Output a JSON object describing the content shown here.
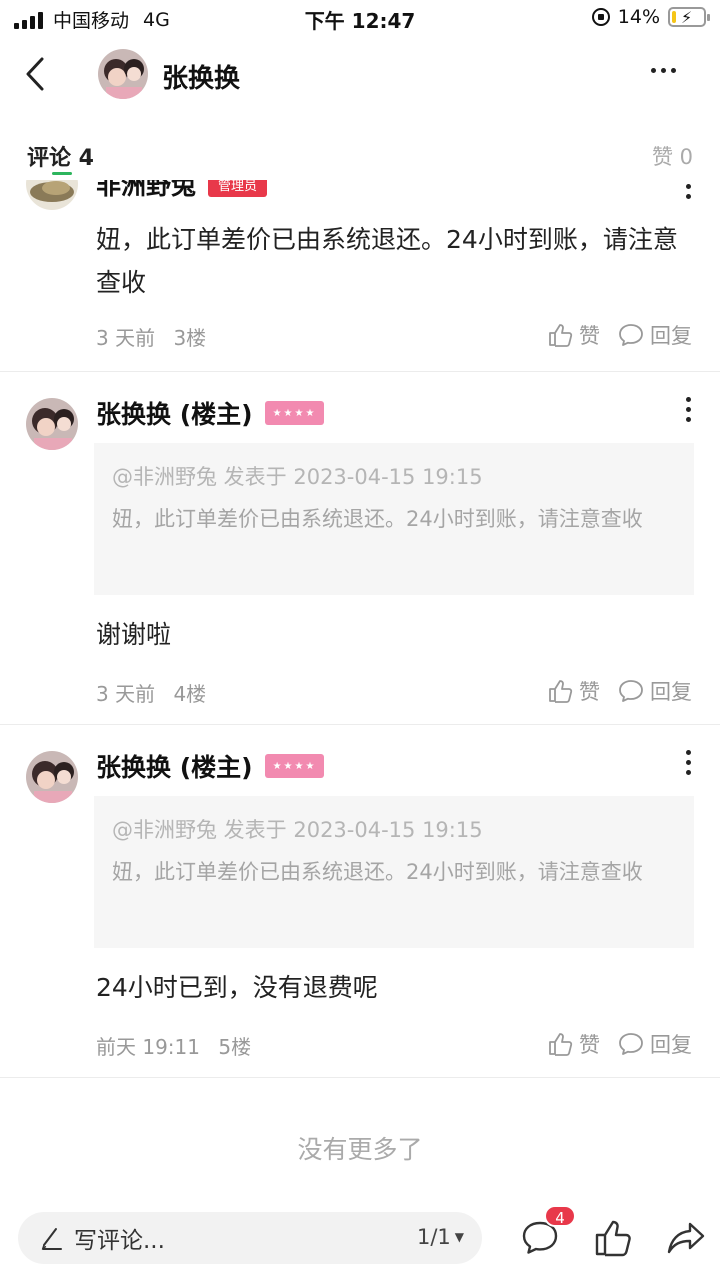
{
  "status_bar": {
    "carrier": "中国移动",
    "network": "4G",
    "time": "下午 12:47",
    "battery": "14%",
    "battery_level": 0.14
  },
  "header": {
    "title": "张换换"
  },
  "tabs": {
    "comments_label": "评论 4",
    "likes_label": "赞 0"
  },
  "comments": [
    {
      "author": "非洲野兔",
      "badge": "管理员",
      "text": "妞，此订单差价已由系统退还。24小时到账，请注意查收",
      "time": "3 天前",
      "floor": "3楼",
      "like_label": "赞",
      "reply_label": "回复"
    },
    {
      "author": "张换换 (楼主)",
      "badge": "★★★★",
      "quote_meta": "@非洲野兔 发表于 2023-04-15 19:15",
      "quote_text": "妞，此订单差价已由系统退还。24小时到账，请注意查收",
      "text": "谢谢啦",
      "time": "3 天前",
      "floor": "4楼",
      "like_label": "赞",
      "reply_label": "回复"
    },
    {
      "author": "张换换 (楼主)",
      "badge": "★★★★",
      "quote_meta": "@非洲野兔 发表于 2023-04-15 19:15",
      "quote_text": "妞，此订单差价已由系统退还。24小时到账，请注意查收",
      "text": "24小时已到，没有退费呢",
      "time": "前天 19:11",
      "floor": "5楼",
      "like_label": "赞",
      "reply_label": "回复"
    }
  ],
  "footer_text": "没有更多了",
  "bottom_bar": {
    "input_placeholder": "写评论...",
    "page": "1/1",
    "comment_badge": "4"
  },
  "colors": {
    "accent": "#2db55d",
    "badge_red": "#e8384a",
    "level_pink": "#f28ab0"
  }
}
